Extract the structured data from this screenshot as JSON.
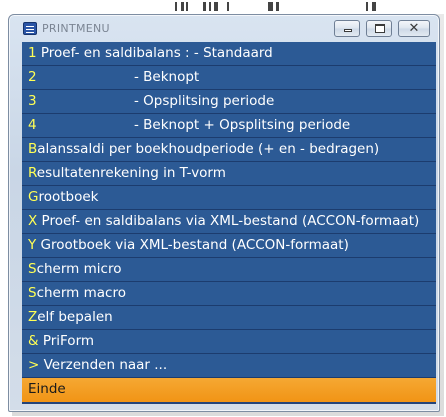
{
  "window": {
    "title": "PRINTMENU",
    "controls": {
      "minimize_icon": "minimize-icon",
      "maximize_icon": "maximize-icon",
      "close_icon": "close-icon",
      "close_glyph": "✕"
    }
  },
  "menu": {
    "items": [
      {
        "hotkey": "1",
        "text": " Proef- en saldibalans : - Standaard",
        "indent": false
      },
      {
        "hotkey": "2",
        "text": "- Beknopt",
        "indent": true
      },
      {
        "hotkey": "3",
        "text": "- Opsplitsing periode",
        "indent": true
      },
      {
        "hotkey": "4",
        "text": "- Beknopt + Opsplitsing periode",
        "indent": true
      },
      {
        "hotkey": "B",
        "text": "alanssaldi per boekhoudperiode (+ en - bedragen)",
        "indent": false
      },
      {
        "hotkey": "R",
        "text": "esultatenrekening in T-vorm",
        "indent": false
      },
      {
        "hotkey": "G",
        "text": "rootboek",
        "indent": false
      },
      {
        "hotkey": "X",
        "text": " Proef- en saldibalans via XML-bestand (ACCON-formaat)",
        "indent": false
      },
      {
        "hotkey": "Y",
        "text": " Grootboek via XML-bestand (ACCON-formaat)",
        "indent": false
      },
      {
        "hotkey": "S",
        "text": "cherm micro",
        "indent": false
      },
      {
        "hotkey": "S",
        "text": "cherm macro",
        "indent": false
      },
      {
        "hotkey": "Z",
        "text": "elf bepalen",
        "indent": false
      },
      {
        "hotkey": "&",
        "text": " PriForm",
        "indent": false
      },
      {
        "hotkey": ">",
        "text": " Verzenden naar ...",
        "indent": false
      },
      {
        "hotkey": "",
        "text": "Einde",
        "indent": false,
        "selected": true
      }
    ]
  },
  "colors": {
    "item_bg": "#2c5a95",
    "hotkey": "#ffff55",
    "selected_bg": "#f19415"
  }
}
